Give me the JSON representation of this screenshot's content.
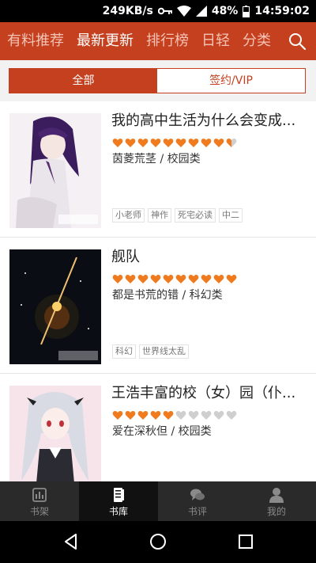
{
  "status_bar": {
    "speed": "249KB/s",
    "battery": "48%",
    "time": "14:59:02"
  },
  "top_nav": {
    "items": [
      {
        "label": "有料推荐",
        "active": false
      },
      {
        "label": "最新更新",
        "active": true
      },
      {
        "label": "排行榜",
        "active": false
      },
      {
        "label": "日轻",
        "active": false
      },
      {
        "label": "分类",
        "active": false
      }
    ],
    "search_icon": "search-icon"
  },
  "segment": {
    "all": "全部",
    "vip": "签约/VIP"
  },
  "books": [
    {
      "title": "我的高中生活为什么会变成...",
      "rating": 9.5,
      "meta": "茵菱荒茎 / 校园类",
      "tags": [
        "小老师",
        "神作",
        "死宅必读",
        "中二"
      ]
    },
    {
      "title": "舰队",
      "rating": 10,
      "meta": "都是书荒的错 / 科幻类",
      "tags": [
        "科幻",
        "世界线太乱"
      ]
    },
    {
      "title": "王浩丰富的校（女）园（仆...",
      "rating": 5,
      "meta": "爱在深秋但 / 校园类",
      "tags": []
    }
  ],
  "tab_bar": {
    "items": [
      {
        "label": "书架",
        "icon": "bookshelf-icon",
        "active": false
      },
      {
        "label": "书库",
        "icon": "library-icon",
        "active": true
      },
      {
        "label": "书评",
        "icon": "comments-icon",
        "active": false
      },
      {
        "label": "我的",
        "icon": "profile-icon",
        "active": false
      }
    ]
  },
  "colors": {
    "accent": "#c4401e",
    "heart_on": "#f07b1e",
    "heart_off": "#cfcfcf",
    "tabbar": "#2a2a2a"
  }
}
